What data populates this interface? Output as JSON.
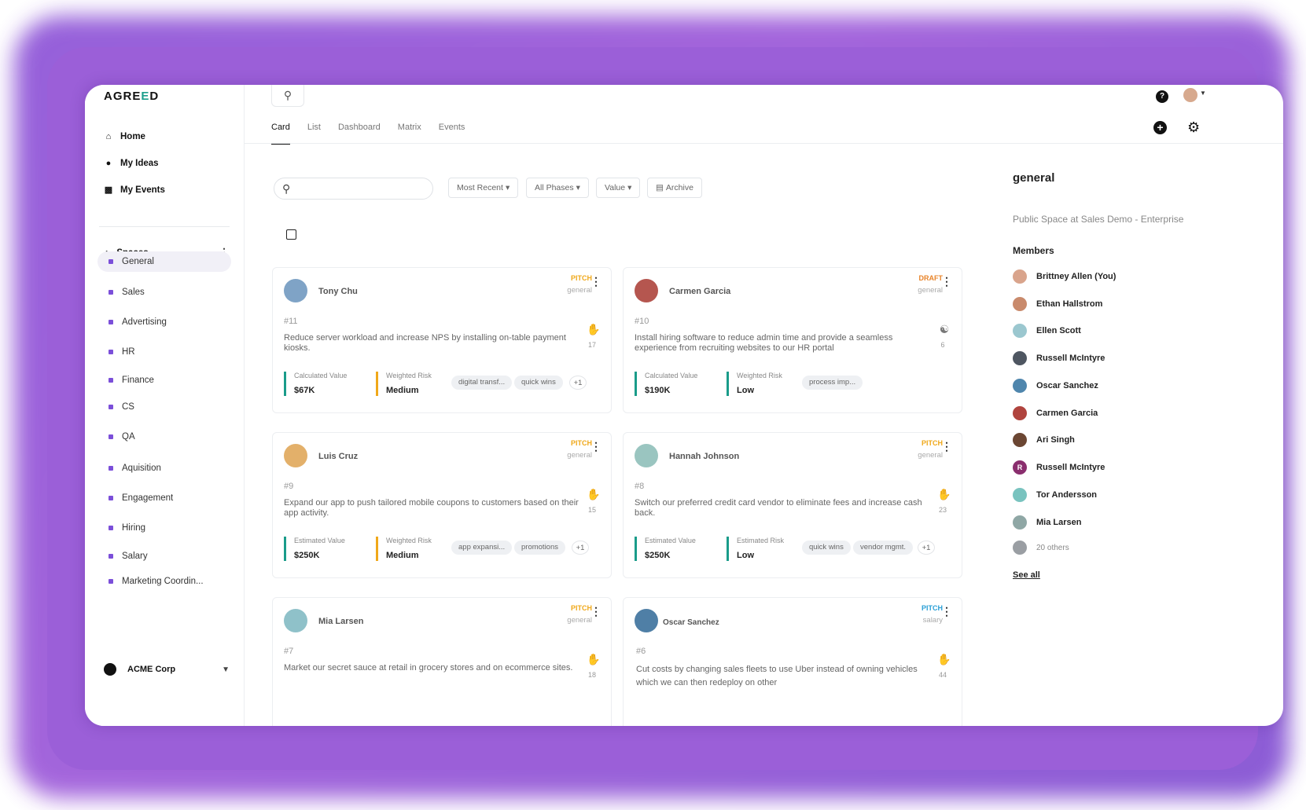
{
  "app": {
    "logo_prefix": "AGRE",
    "logo_e": "E",
    "logo_suffix": "D"
  },
  "sidebar": {
    "nav": [
      {
        "label": "Home",
        "icon": "home-icon"
      },
      {
        "label": "My Ideas",
        "icon": "lightbulb-icon"
      },
      {
        "label": "My Events",
        "icon": "calendar-icon"
      }
    ],
    "spaces_label": "Spaces",
    "spaces": [
      "General",
      "Sales",
      "Advertising",
      "HR",
      "Finance",
      "CS",
      "QA",
      "Aquisition",
      "Engagement",
      "Hiring",
      "Salary",
      "Marketing Coordin..."
    ],
    "active_space": "General",
    "org": "ACME Corp"
  },
  "header": {
    "tabs": [
      "Card",
      "List",
      "Dashboard",
      "Matrix",
      "Events"
    ],
    "active_tab": "Card",
    "help": "?"
  },
  "filters": {
    "search_placeholder": "",
    "sort": "Most Recent",
    "phase": "All Phases",
    "value": "Value",
    "archive": "Archive"
  },
  "cards": [
    {
      "name": "Tony Chu",
      "status": "PITCH",
      "status_color": "#f0a81a",
      "space": "general",
      "num": "#11",
      "title": "Reduce server workload and increase NPS by installing on-table payment kiosks.",
      "votes": "17",
      "m1_label": "Calculated Value",
      "m1_value": "$67K",
      "m2_label": "Weighted Risk",
      "m2_value": "Medium",
      "tags": [
        "digital transf...",
        "quick wins"
      ],
      "more": "+1",
      "avatar_color": "#7fa3c6"
    },
    {
      "name": "Carmen Garcia",
      "status": "DRAFT",
      "status_color": "#e8842a",
      "space": "general",
      "num": "#10",
      "title": "Install hiring software to reduce admin time and provide a seamless experience from recruiting websites to our HR portal",
      "votes": "6",
      "m1_label": "Calculated Value",
      "m1_value": "$190K",
      "m2_label": "Weighted Risk",
      "m2_value": "Low",
      "tags": [
        "process imp..."
      ],
      "more": "",
      "avatar_color": "#b5564f"
    },
    {
      "name": "Luis Cruz",
      "status": "PITCH",
      "status_color": "#f0a81a",
      "space": "general",
      "num": "#9",
      "title": "Expand our app to push tailored mobile coupons to customers based on their app activity.",
      "votes": "15",
      "m1_label": "Estimated Value",
      "m1_value": "$250K",
      "m2_label": "Weighted Risk",
      "m2_value": "Medium",
      "tags": [
        "app expansi...",
        "promotions"
      ],
      "more": "+1",
      "avatar_color": "#e3b06a"
    },
    {
      "name": "Hannah Johnson",
      "status": "PITCH",
      "status_color": "#f0a81a",
      "space": "general",
      "num": "#8",
      "title": "Switch our preferred credit card vendor to eliminate fees and increase cash back.",
      "votes": "23",
      "m1_label": "Estimated Value",
      "m1_value": "$250K",
      "m2_label": "Estimated Risk",
      "m2_value": "Low",
      "tags": [
        "quick wins",
        "vendor mgmt."
      ],
      "more": "+1",
      "avatar_color": "#9ac5c0"
    },
    {
      "name": "Mia Larsen",
      "status": "PITCH",
      "status_color": "#f0a81a",
      "space": "general",
      "num": "#7",
      "title": "Market our secret sauce at retail in grocery stores and on ecommerce sites.",
      "votes": "18",
      "avatar_color": "#8fc1c9"
    },
    {
      "name": "Oscar Sanchez",
      "status": "PITCH",
      "status_color": "#2a9fd6",
      "space": "salary",
      "num": "#6",
      "title": "Cut costs by changing sales fleets to use Uber instead of owning vehicles which we can then redeploy on other",
      "votes": "44",
      "avatar_color": "#4f7fa6"
    }
  ],
  "panel": {
    "title": "general",
    "subtitle": "Public Space at Sales Demo - Enterprise",
    "members_label": "Members",
    "members": [
      {
        "name": "Brittney Allen (You)",
        "color": "#d9a48c",
        "initial": ""
      },
      {
        "name": "Ethan Hallstrom",
        "color": "#c98a6c",
        "initial": ""
      },
      {
        "name": "Ellen Scott",
        "color": "#9bc7cf",
        "initial": ""
      },
      {
        "name": "Russell McIntyre",
        "color": "#4e5661",
        "initial": ""
      },
      {
        "name": "Oscar Sanchez",
        "color": "#4f86ad",
        "initial": ""
      },
      {
        "name": "Carmen Garcia",
        "color": "#b0443e",
        "initial": ""
      },
      {
        "name": "Ari Singh",
        "color": "#6b4633",
        "initial": ""
      },
      {
        "name": "Russell McIntyre",
        "color": "#8a2e6e",
        "initial": "R"
      },
      {
        "name": "Tor Andersson",
        "color": "#79c3bf",
        "initial": ""
      },
      {
        "name": "Mia Larsen",
        "color": "#8fa7a5",
        "initial": ""
      }
    ],
    "others": "20 others",
    "see_all": "See all"
  }
}
